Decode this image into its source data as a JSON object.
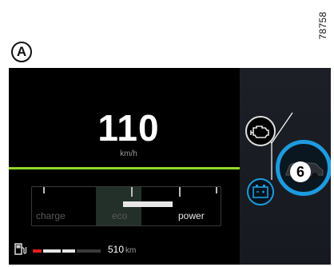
{
  "figure": {
    "reference_number": "78758",
    "callout_label": "A",
    "warning_callout": "6"
  },
  "speed": {
    "value": "110",
    "unit": "km/h"
  },
  "power_gauge": {
    "labels": {
      "charge": "charge",
      "eco": "eco",
      "power": "power"
    },
    "needle_level_fraction": 0.63
  },
  "range": {
    "value": "510",
    "unit": "km",
    "fuel_level_fraction": 0.55
  },
  "warning_lights": [
    {
      "name": "engine-check",
      "icon": "engine-icon",
      "color": "#ffffff"
    },
    {
      "name": "battery-charge",
      "icon": "battery-icon",
      "color": "#1e9be0"
    }
  ],
  "colors": {
    "accent_green": "#8ed92a",
    "accent_blue": "#1e9be0",
    "fuel_low_red": "#e02020"
  }
}
